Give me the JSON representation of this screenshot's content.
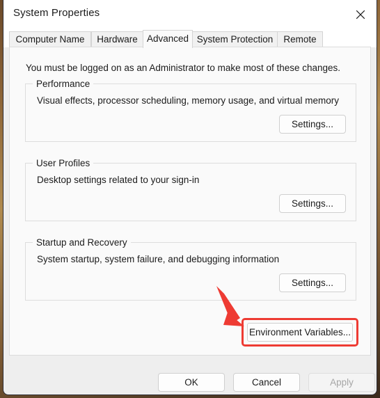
{
  "window": {
    "title": "System Properties",
    "close_icon": "close-icon"
  },
  "tabs": [
    {
      "label": "Computer Name",
      "selected": false
    },
    {
      "label": "Hardware",
      "selected": false
    },
    {
      "label": "Advanced",
      "selected": true
    },
    {
      "label": "System Protection",
      "selected": false
    },
    {
      "label": "Remote",
      "selected": false
    }
  ],
  "panel": {
    "admin_note": "You must be logged on as an Administrator to make most of these changes.",
    "groups": [
      {
        "legend": "Performance",
        "description": "Visual effects, processor scheduling, memory usage, and virtual memory",
        "button_label": "Settings..."
      },
      {
        "legend": "User Profiles",
        "description": "Desktop settings related to your sign-in",
        "button_label": "Settings..."
      },
      {
        "legend": "Startup and Recovery",
        "description": "System startup, system failure, and debugging information",
        "button_label": "Settings..."
      }
    ],
    "environment_variables_button": "Environment Variables..."
  },
  "footer": {
    "ok_label": "OK",
    "cancel_label": "Cancel",
    "apply_label": "Apply",
    "apply_disabled": true
  },
  "annotation": {
    "color": "#ee3b33",
    "highlight_target": "Environment Variables...",
    "arrow": "down-right-arrow"
  }
}
